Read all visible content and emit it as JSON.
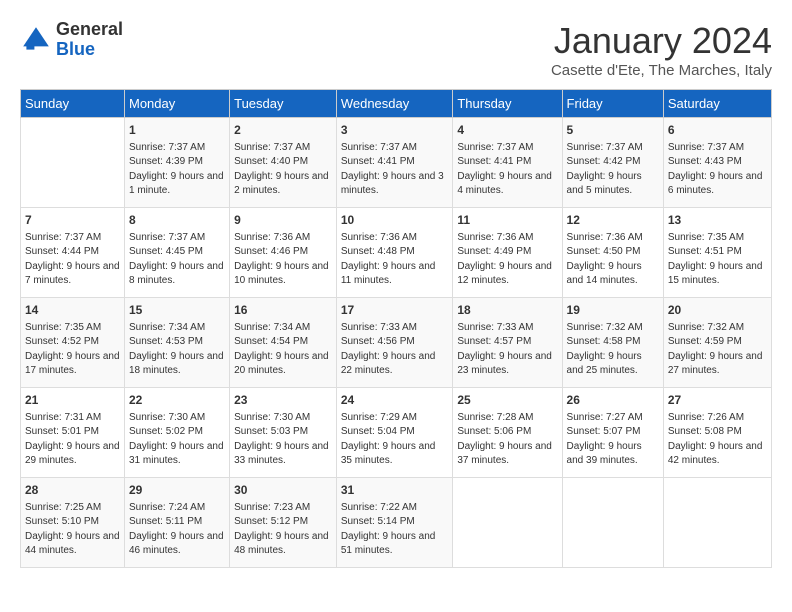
{
  "logo": {
    "general": "General",
    "blue": "Blue"
  },
  "header": {
    "month": "January 2024",
    "location": "Casette d'Ete, The Marches, Italy"
  },
  "days_of_week": [
    "Sunday",
    "Monday",
    "Tuesday",
    "Wednesday",
    "Thursday",
    "Friday",
    "Saturday"
  ],
  "weeks": [
    [
      {
        "day": "",
        "sunrise": "",
        "sunset": "",
        "daylight": ""
      },
      {
        "day": "1",
        "sunrise": "Sunrise: 7:37 AM",
        "sunset": "Sunset: 4:39 PM",
        "daylight": "Daylight: 9 hours and 1 minute."
      },
      {
        "day": "2",
        "sunrise": "Sunrise: 7:37 AM",
        "sunset": "Sunset: 4:40 PM",
        "daylight": "Daylight: 9 hours and 2 minutes."
      },
      {
        "day": "3",
        "sunrise": "Sunrise: 7:37 AM",
        "sunset": "Sunset: 4:41 PM",
        "daylight": "Daylight: 9 hours and 3 minutes."
      },
      {
        "day": "4",
        "sunrise": "Sunrise: 7:37 AM",
        "sunset": "Sunset: 4:41 PM",
        "daylight": "Daylight: 9 hours and 4 minutes."
      },
      {
        "day": "5",
        "sunrise": "Sunrise: 7:37 AM",
        "sunset": "Sunset: 4:42 PM",
        "daylight": "Daylight: 9 hours and 5 minutes."
      },
      {
        "day": "6",
        "sunrise": "Sunrise: 7:37 AM",
        "sunset": "Sunset: 4:43 PM",
        "daylight": "Daylight: 9 hours and 6 minutes."
      }
    ],
    [
      {
        "day": "7",
        "sunrise": "Sunrise: 7:37 AM",
        "sunset": "Sunset: 4:44 PM",
        "daylight": "Daylight: 9 hours and 7 minutes."
      },
      {
        "day": "8",
        "sunrise": "Sunrise: 7:37 AM",
        "sunset": "Sunset: 4:45 PM",
        "daylight": "Daylight: 9 hours and 8 minutes."
      },
      {
        "day": "9",
        "sunrise": "Sunrise: 7:36 AM",
        "sunset": "Sunset: 4:46 PM",
        "daylight": "Daylight: 9 hours and 10 minutes."
      },
      {
        "day": "10",
        "sunrise": "Sunrise: 7:36 AM",
        "sunset": "Sunset: 4:48 PM",
        "daylight": "Daylight: 9 hours and 11 minutes."
      },
      {
        "day": "11",
        "sunrise": "Sunrise: 7:36 AM",
        "sunset": "Sunset: 4:49 PM",
        "daylight": "Daylight: 9 hours and 12 minutes."
      },
      {
        "day": "12",
        "sunrise": "Sunrise: 7:36 AM",
        "sunset": "Sunset: 4:50 PM",
        "daylight": "Daylight: 9 hours and 14 minutes."
      },
      {
        "day": "13",
        "sunrise": "Sunrise: 7:35 AM",
        "sunset": "Sunset: 4:51 PM",
        "daylight": "Daylight: 9 hours and 15 minutes."
      }
    ],
    [
      {
        "day": "14",
        "sunrise": "Sunrise: 7:35 AM",
        "sunset": "Sunset: 4:52 PM",
        "daylight": "Daylight: 9 hours and 17 minutes."
      },
      {
        "day": "15",
        "sunrise": "Sunrise: 7:34 AM",
        "sunset": "Sunset: 4:53 PM",
        "daylight": "Daylight: 9 hours and 18 minutes."
      },
      {
        "day": "16",
        "sunrise": "Sunrise: 7:34 AM",
        "sunset": "Sunset: 4:54 PM",
        "daylight": "Daylight: 9 hours and 20 minutes."
      },
      {
        "day": "17",
        "sunrise": "Sunrise: 7:33 AM",
        "sunset": "Sunset: 4:56 PM",
        "daylight": "Daylight: 9 hours and 22 minutes."
      },
      {
        "day": "18",
        "sunrise": "Sunrise: 7:33 AM",
        "sunset": "Sunset: 4:57 PM",
        "daylight": "Daylight: 9 hours and 23 minutes."
      },
      {
        "day": "19",
        "sunrise": "Sunrise: 7:32 AM",
        "sunset": "Sunset: 4:58 PM",
        "daylight": "Daylight: 9 hours and 25 minutes."
      },
      {
        "day": "20",
        "sunrise": "Sunrise: 7:32 AM",
        "sunset": "Sunset: 4:59 PM",
        "daylight": "Daylight: 9 hours and 27 minutes."
      }
    ],
    [
      {
        "day": "21",
        "sunrise": "Sunrise: 7:31 AM",
        "sunset": "Sunset: 5:01 PM",
        "daylight": "Daylight: 9 hours and 29 minutes."
      },
      {
        "day": "22",
        "sunrise": "Sunrise: 7:30 AM",
        "sunset": "Sunset: 5:02 PM",
        "daylight": "Daylight: 9 hours and 31 minutes."
      },
      {
        "day": "23",
        "sunrise": "Sunrise: 7:30 AM",
        "sunset": "Sunset: 5:03 PM",
        "daylight": "Daylight: 9 hours and 33 minutes."
      },
      {
        "day": "24",
        "sunrise": "Sunrise: 7:29 AM",
        "sunset": "Sunset: 5:04 PM",
        "daylight": "Daylight: 9 hours and 35 minutes."
      },
      {
        "day": "25",
        "sunrise": "Sunrise: 7:28 AM",
        "sunset": "Sunset: 5:06 PM",
        "daylight": "Daylight: 9 hours and 37 minutes."
      },
      {
        "day": "26",
        "sunrise": "Sunrise: 7:27 AM",
        "sunset": "Sunset: 5:07 PM",
        "daylight": "Daylight: 9 hours and 39 minutes."
      },
      {
        "day": "27",
        "sunrise": "Sunrise: 7:26 AM",
        "sunset": "Sunset: 5:08 PM",
        "daylight": "Daylight: 9 hours and 42 minutes."
      }
    ],
    [
      {
        "day": "28",
        "sunrise": "Sunrise: 7:25 AM",
        "sunset": "Sunset: 5:10 PM",
        "daylight": "Daylight: 9 hours and 44 minutes."
      },
      {
        "day": "29",
        "sunrise": "Sunrise: 7:24 AM",
        "sunset": "Sunset: 5:11 PM",
        "daylight": "Daylight: 9 hours and 46 minutes."
      },
      {
        "day": "30",
        "sunrise": "Sunrise: 7:23 AM",
        "sunset": "Sunset: 5:12 PM",
        "daylight": "Daylight: 9 hours and 48 minutes."
      },
      {
        "day": "31",
        "sunrise": "Sunrise: 7:22 AM",
        "sunset": "Sunset: 5:14 PM",
        "daylight": "Daylight: 9 hours and 51 minutes."
      },
      {
        "day": "",
        "sunrise": "",
        "sunset": "",
        "daylight": ""
      },
      {
        "day": "",
        "sunrise": "",
        "sunset": "",
        "daylight": ""
      },
      {
        "day": "",
        "sunrise": "",
        "sunset": "",
        "daylight": ""
      }
    ]
  ]
}
